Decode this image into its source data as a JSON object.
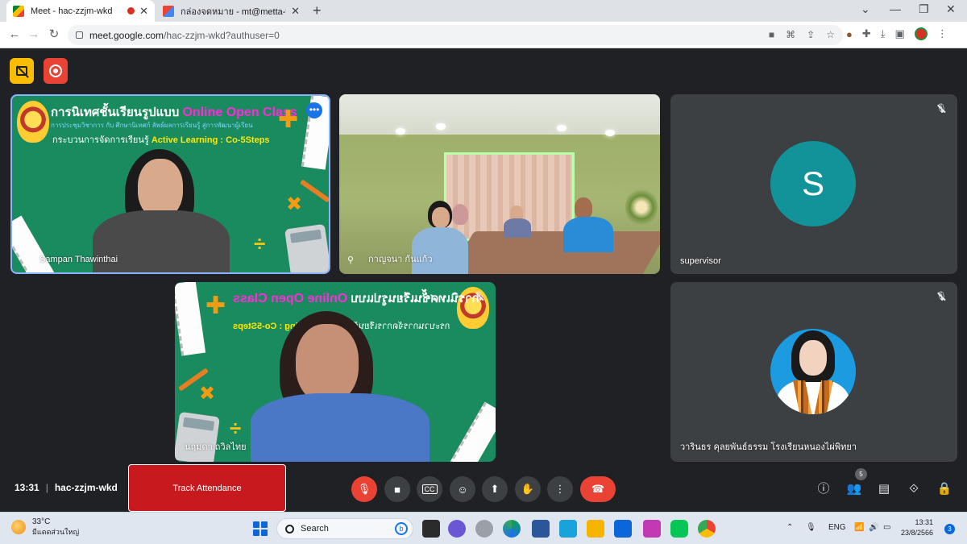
{
  "browser": {
    "tabs": [
      {
        "title": "Meet - hac-zzjm-wkd",
        "active": true,
        "recording": true
      },
      {
        "title": "กล่องจดหมาย - mt@metta-tt.info -",
        "active": false
      }
    ],
    "new_tab": "+",
    "url_host": "meet.google.com",
    "url_path": "/hac-zzjm-wkd?authuser=0"
  },
  "meet": {
    "tiles": [
      {
        "name": "Sampan Thawinthai",
        "type": "presentation-board",
        "board": {
          "line1_prefix": "การนิเทศชั้นเรียนรูปแบบ ",
          "line1_highlight": "Online Open Class",
          "line2": "การประชุมวิชาการ กับ ศึกษานิเทศก์ ลัพธ์ผลการเรียนรู้ สู่การพัฒนาผู้เรียน",
          "line3_prefix": "กระบวนการจัดการเรียนรู้ ",
          "line3_highlight": "Active Learning : Co-5Steps"
        },
        "pinned": true,
        "has_more_options": true
      },
      {
        "name": "กาญจนา กันแก้ว",
        "type": "room-camera",
        "pinned": true
      },
      {
        "name": "supervisor",
        "type": "avatar-letter",
        "avatar_letter": "S",
        "avatar_color": "#12939a",
        "muted": true
      },
      {
        "name": "นฤมดา ถวิลไทย",
        "type": "presentation-board-mirrored",
        "muted": true
      },
      {
        "name": "วารินธร คุลยพันธ์ธรรม โรงเรียนหนองไผ่พิทยา",
        "type": "avatar-photo",
        "muted": true
      }
    ],
    "meeting_time": "13:31",
    "meeting_code": "hac-zzjm-wkd",
    "track_attendance_label": "Track Attendance",
    "people_count": "5",
    "controls": [
      "mic-off-icon",
      "camera-icon",
      "captions-icon",
      "emoji-icon",
      "present-icon",
      "raise-hand-icon",
      "more-options-icon",
      "hang-up-icon"
    ],
    "right_controls": [
      "info-icon",
      "people-icon",
      "chat-icon",
      "activities-icon",
      "host-controls-icon"
    ]
  },
  "taskbar": {
    "weather_temp": "33°C",
    "weather_desc": "มีแดดส่วนใหญ่",
    "search_label": "Search",
    "language": "ENG",
    "time": "13:31",
    "date": "23/8/2566",
    "notifications": "3"
  },
  "colors": {
    "meet_bg": "#202124",
    "tile_bg": "#3c4043",
    "danger": "#ea4335",
    "track_attendance": "#c8191e",
    "board_green": "#1a8a5f",
    "highlight_magenta": "#ff2bd8",
    "highlight_yellow": "#ffe800"
  }
}
